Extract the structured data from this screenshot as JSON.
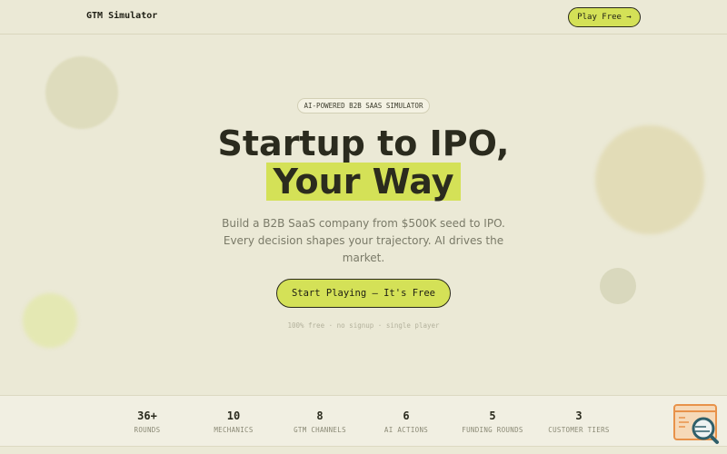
{
  "header": {
    "logo": "GTM Simulator",
    "play_button": "Play Free →"
  },
  "hero": {
    "badge": "AI-POWERED B2B SAAS SIMULATOR",
    "title_line1": "Startup to IPO,",
    "title_line2": "Your Way",
    "subtitle": "Build a B2B SaaS company from $500K seed to IPO. Every decision shapes your trajectory. AI drives the market.",
    "cta": "Start Playing — It's Free",
    "note": "100% free · no signup · single player"
  },
  "stats": [
    {
      "value": "36+",
      "label": "ROUNDS"
    },
    {
      "value": "10",
      "label": "MECHANICS"
    },
    {
      "value": "8",
      "label": "GTM CHANNELS"
    },
    {
      "value": "6",
      "label": "AI ACTIONS"
    },
    {
      "value": "5",
      "label": "FUNDING ROUNDS"
    },
    {
      "value": "3",
      "label": "CUSTOMER TIERS"
    }
  ],
  "colors": {
    "background": "#ebe9d6",
    "accent": "#d4e157",
    "text": "#2b2b1e",
    "muted": "#7a7a68"
  },
  "icons": {
    "corner_widget": "terminal-search-icon"
  }
}
